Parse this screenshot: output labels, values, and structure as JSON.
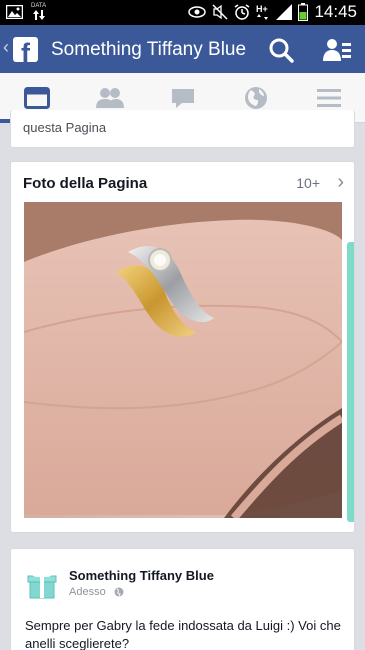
{
  "status_bar": {
    "time": "14:45",
    "data_label": "DATA",
    "icons": [
      "picture-icon",
      "data-transfer-icon",
      "eye-icon",
      "mute-icon",
      "alarm-icon",
      "h-plus-icon",
      "signal-icon",
      "battery-icon"
    ]
  },
  "header": {
    "title": "Something Tiffany Blue",
    "logo_letter": "f",
    "back_glyph": "‹",
    "icons": [
      "search-icon",
      "friends-icon"
    ],
    "color": "#3b5998"
  },
  "tabs": [
    {
      "name": "news-feed",
      "icon": "newsfeed-icon",
      "active": true
    },
    {
      "name": "friend-requests",
      "icon": "friends-icon",
      "active": false
    },
    {
      "name": "messages",
      "icon": "chat-icon",
      "active": false
    },
    {
      "name": "notifications",
      "icon": "globe-icon",
      "active": false
    },
    {
      "name": "more",
      "icon": "menu-icon",
      "active": false
    }
  ],
  "top_card": {
    "text": "questa Pagina"
  },
  "photos_card": {
    "title": "Foto della Pagina",
    "count": "10+",
    "chevron": "›",
    "peek_color": "#7ddbc8"
  },
  "post": {
    "page_name": "Something Tiffany Blue",
    "time": "Adesso",
    "text": "Sempre per Gabry la fede indossata da Luigi :) Voi che anelli sceglierete?"
  }
}
